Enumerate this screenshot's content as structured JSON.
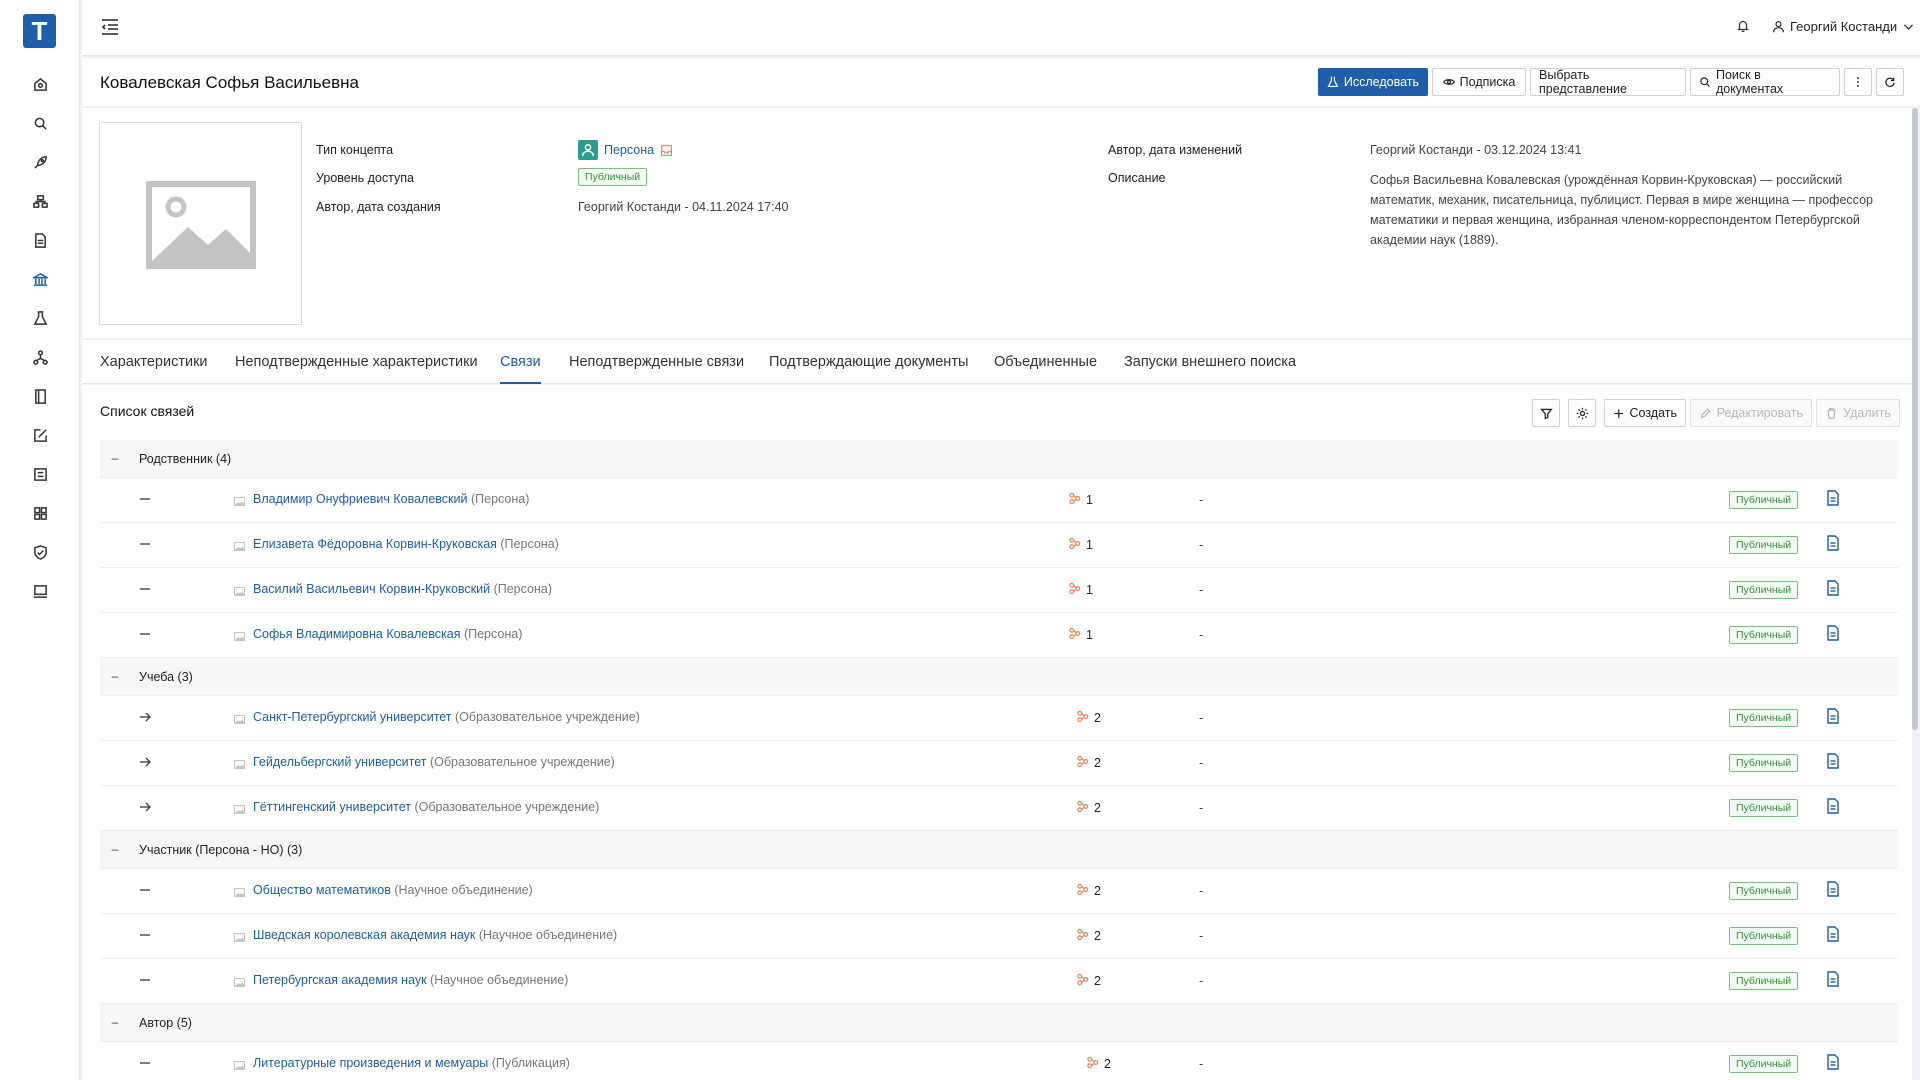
{
  "app": {
    "logo_letter": "T"
  },
  "sidebar": {
    "icons": [
      "home-icon",
      "search-icon",
      "rocket-icon",
      "hierarchy-icon",
      "document-icon",
      "bank-icon",
      "flask-icon",
      "network-icon",
      "book-icon",
      "edit-icon",
      "form-icon",
      "dashboard-icon",
      "shield-icon",
      "monitor-icon"
    ],
    "active_index": 5
  },
  "header": {
    "user_name": "Георгий Костанди"
  },
  "page": {
    "title": "Ковалевская Софья Васильевна",
    "buttons": {
      "research": "Исследовать",
      "subscribe": "Подписка",
      "choose_view": "Выбрать представление",
      "search_docs": "Поиск в документах"
    }
  },
  "concept": {
    "type_label": "Тип концепта",
    "type_value": "Персона",
    "access_label": "Уровень доступа",
    "access_value": "Публичный",
    "created_label": "Автор, дата создания",
    "created_value": "Георгий Костанди - 04.11.2024 17:40",
    "modified_label": "Автор, дата изменений",
    "modified_value": "Георгий Костанди - 03.12.2024 13:41",
    "description_label": "Описание",
    "description_value": "Софья Васильевна Ковалевская (урождённая Корвин-Круковская) — российский математик, механик, писательница, публицист. Первая в мире женщина — профессор математики и первая женщина, избранная членом-корреспондентом Петербургской академии наук (1889)."
  },
  "tabs": [
    "Характеристики",
    "Неподтвержденные характеристики",
    "Связи",
    "Неподтвержденные связи",
    "Подтверждающие документы",
    "Объединенные",
    "Запуски внешнего поиска"
  ],
  "active_tab": 2,
  "relations": {
    "title": "Список связей",
    "create_label": "Создать",
    "edit_label": "Редактировать",
    "delete_label": "Удалить",
    "access_badge": "Публичный",
    "empty_value": "-",
    "collapse_symbol": "–",
    "groups": [
      {
        "title": "Родственник (4)",
        "rows": [
          {
            "direction": "none",
            "name": "Владимир Онуфриевич Ковалевский",
            "type": "(Персона)",
            "count": "1"
          },
          {
            "direction": "none",
            "name": "Елизавета Фёдоровна Корвин-Круковская",
            "type": "(Персона)",
            "count": "1"
          },
          {
            "direction": "none",
            "name": "Василий Васильевич Корвин-Круковский",
            "type": "(Персона)",
            "count": "1"
          },
          {
            "direction": "none",
            "name": "Софья Владимировна Ковалевская",
            "type": "(Персона)",
            "count": "1"
          }
        ]
      },
      {
        "title": "Учеба (3)",
        "rows": [
          {
            "direction": "arrow",
            "name": "Санкт-Петербургский университет",
            "type": "(Образовательное учреждение)",
            "count": "2"
          },
          {
            "direction": "arrow",
            "name": "Гейдельбергский университет",
            "type": "(Образовательное учреждение)",
            "count": "2"
          },
          {
            "direction": "arrow",
            "name": "Гёттингенский университет",
            "type": "(Образовательное учреждение)",
            "count": "2"
          }
        ]
      },
      {
        "title": "Участник (Персона - НО) (3)",
        "rows": [
          {
            "direction": "none",
            "name": "Общество математиков",
            "type": "(Научное объединение)",
            "count": "2"
          },
          {
            "direction": "none",
            "name": "Шведская королевская академия наук",
            "type": "(Научное объединение)",
            "count": "2"
          },
          {
            "direction": "none",
            "name": "Петербургская академия наук",
            "type": "(Научное объединение)",
            "count": "2"
          }
        ]
      },
      {
        "title": "Автор (5)",
        "rows": [
          {
            "direction": "none",
            "name": "Литературные произведения и мемуары",
            "type": "(Публикация)",
            "count": "2"
          }
        ]
      }
    ]
  },
  "colors": {
    "accent": "#1f5ea8",
    "badge_green": "#3b8f3b",
    "link_icon": "#e8845a"
  }
}
